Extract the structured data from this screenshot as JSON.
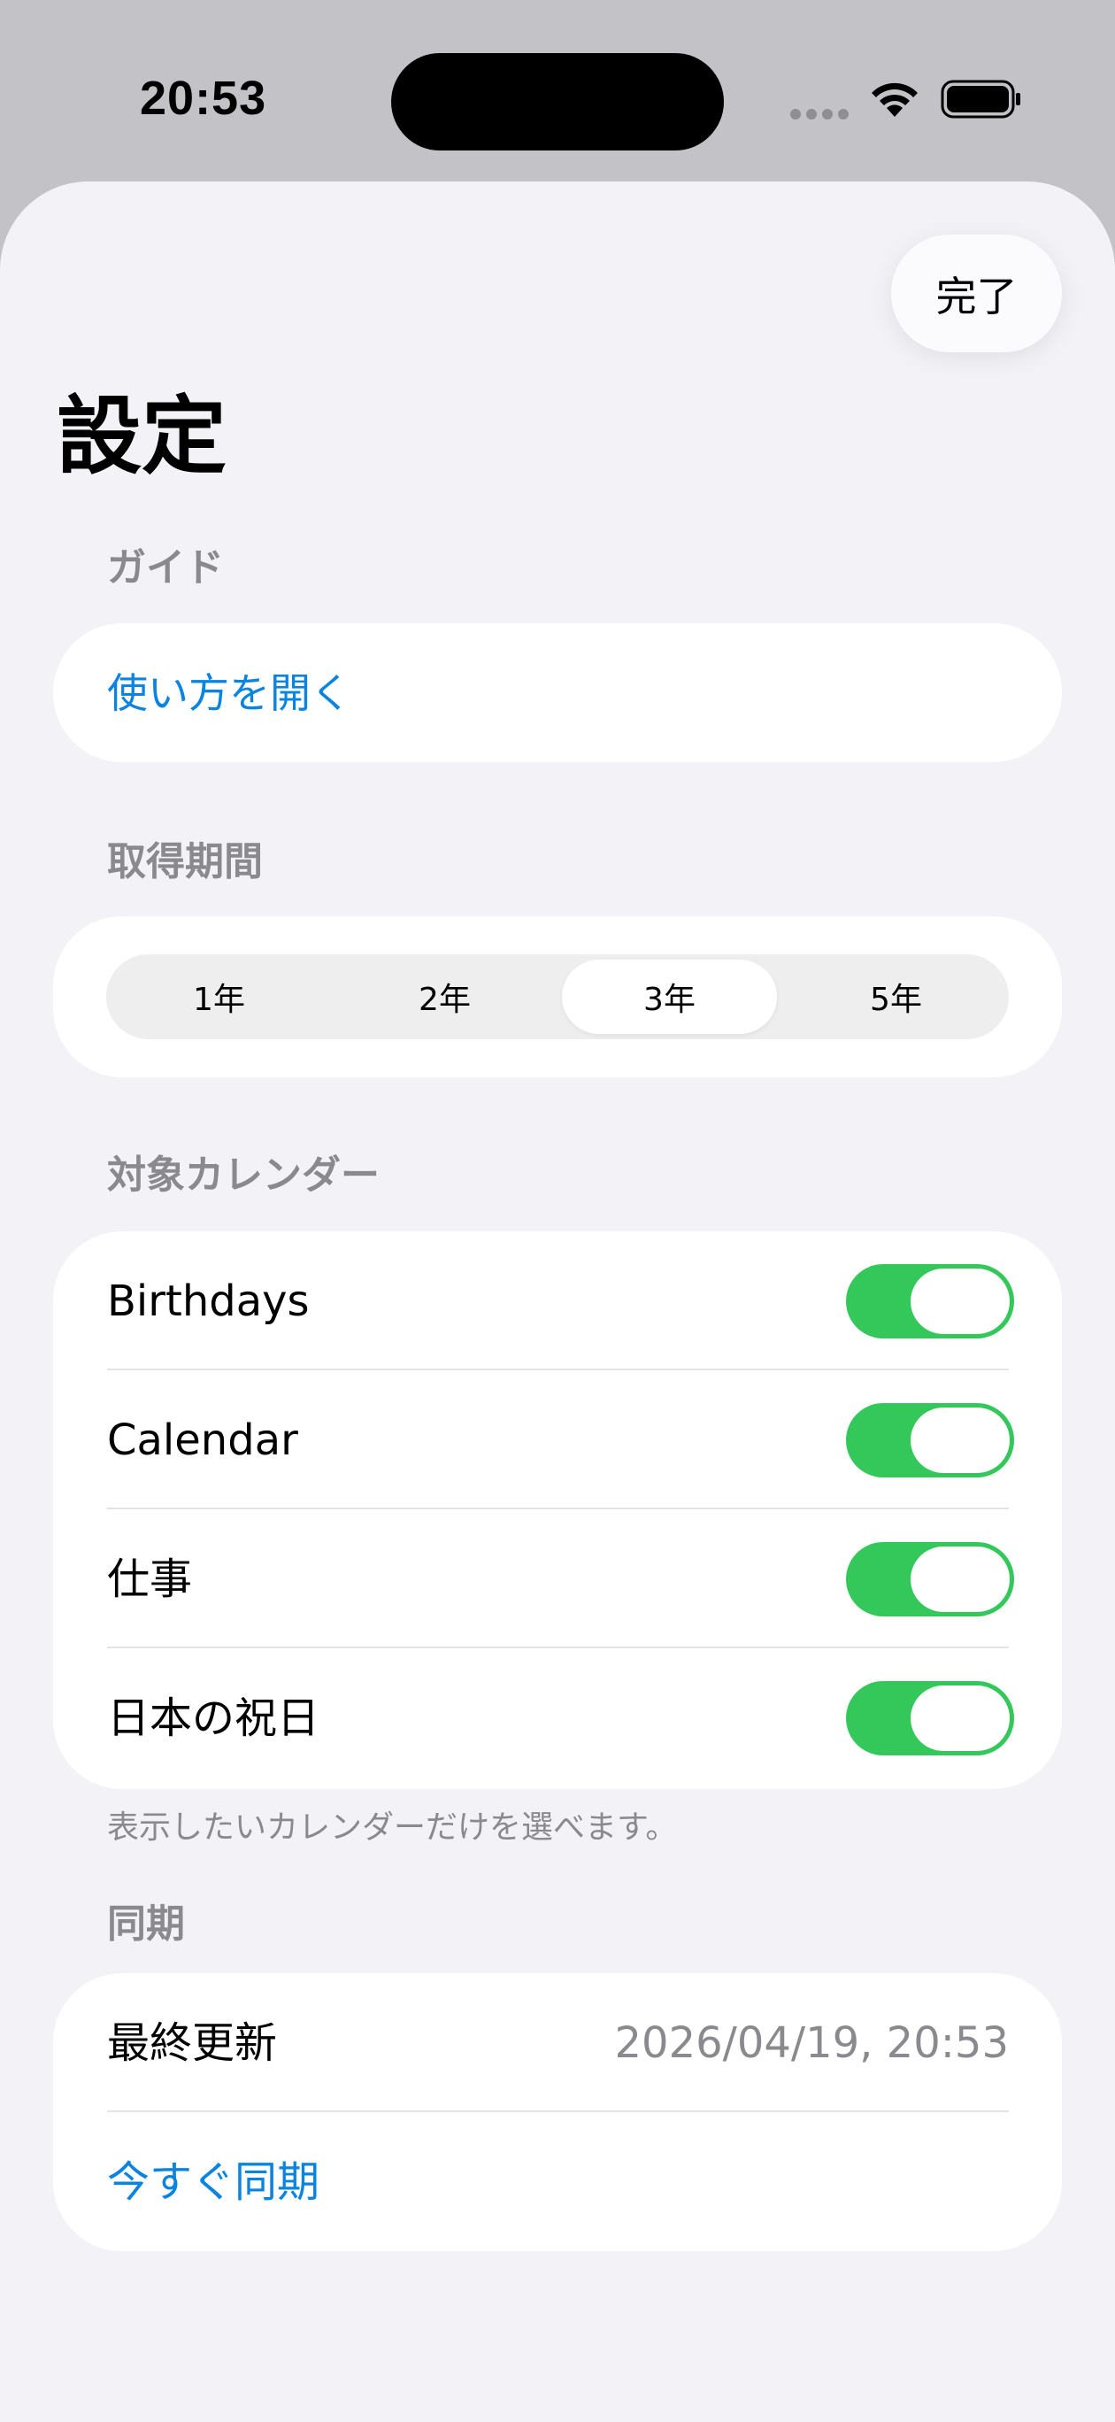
{
  "status_bar": {
    "time": "20:53"
  },
  "header": {
    "done_label": "完了",
    "title": "設定"
  },
  "guide": {
    "header": "ガイド",
    "open_label": "使い方を開く"
  },
  "period": {
    "header": "取得期間",
    "options": [
      "1年",
      "2年",
      "3年",
      "5年"
    ],
    "selected": "3年"
  },
  "calendars": {
    "header": "対象カレンダー",
    "items": [
      {
        "label": "Birthdays",
        "enabled": true
      },
      {
        "label": "Calendar",
        "enabled": true
      },
      {
        "label": "仕事",
        "enabled": true
      },
      {
        "label": "日本の祝日",
        "enabled": true
      }
    ],
    "footnote": "表示したいカレンダーだけを選べます。"
  },
  "sync": {
    "header": "同期",
    "last_updated_label": "最終更新",
    "last_updated_value": "2026/04/19, 20:53",
    "sync_now_label": "今すぐ同期"
  },
  "colors": {
    "accent": "#0a84e0",
    "toggle_on": "#34c759",
    "background": "#f2f2f7",
    "secondary_text": "#8a8a8e"
  }
}
